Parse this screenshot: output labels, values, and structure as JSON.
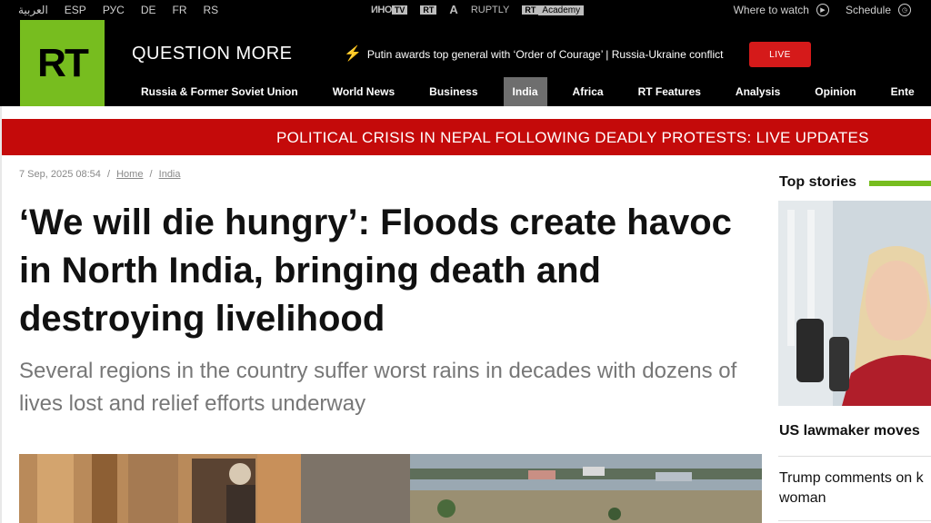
{
  "topbar": {
    "languages": [
      "العربية",
      "ESP",
      "РУС",
      "DE",
      "FR",
      "RS"
    ],
    "partners": {
      "ino": "ИНО",
      "tv": "TV",
      "ruptly": "RUPTLY",
      "rt_box": "RT",
      "arch": "A",
      "academy_rt": "RT",
      "academy": "Academy"
    },
    "where_to_watch": "Where to watch",
    "schedule": "Schedule",
    "icons": {
      "where_to_watch": "play-circle-icon",
      "schedule": "clock-icon"
    }
  },
  "header": {
    "logo": "RT",
    "tagline": "QUESTION MORE",
    "breaking": "Putin awards top general with ‘Order of Courage’ | Russia-Ukraine conflict",
    "live_label": "LIVE",
    "colors": {
      "brand": "#77bd1f",
      "live": "#d51a1a"
    }
  },
  "nav": {
    "items": [
      {
        "label": "Russia & Former Soviet Union"
      },
      {
        "label": "World News"
      },
      {
        "label": "Business"
      },
      {
        "label": "India",
        "active": true
      },
      {
        "label": "Africa"
      },
      {
        "label": "RT Features"
      },
      {
        "label": "Analysis"
      },
      {
        "label": "Opinion"
      },
      {
        "label": "Ente"
      }
    ]
  },
  "banner": {
    "text": "POLITICAL CRISIS IN NEPAL FOLLOWING DEADLY PROTESTS: LIVE UPDATES",
    "color": "#c40a0a"
  },
  "article": {
    "date": "7 Sep, 2025 08:54",
    "breadcrumb": [
      "Home",
      "India"
    ],
    "headline": "‘We will die hungry’: Floods create havoc in North India, bringing death and destroying livelihood",
    "subhead": "Several regions in the country suffer worst rains in decades with dozens of lives lost and relief efforts underway"
  },
  "sidebar": {
    "heading": "Top stories",
    "story1": "US lawmaker moves",
    "story2": "Trump comments on k woman"
  }
}
